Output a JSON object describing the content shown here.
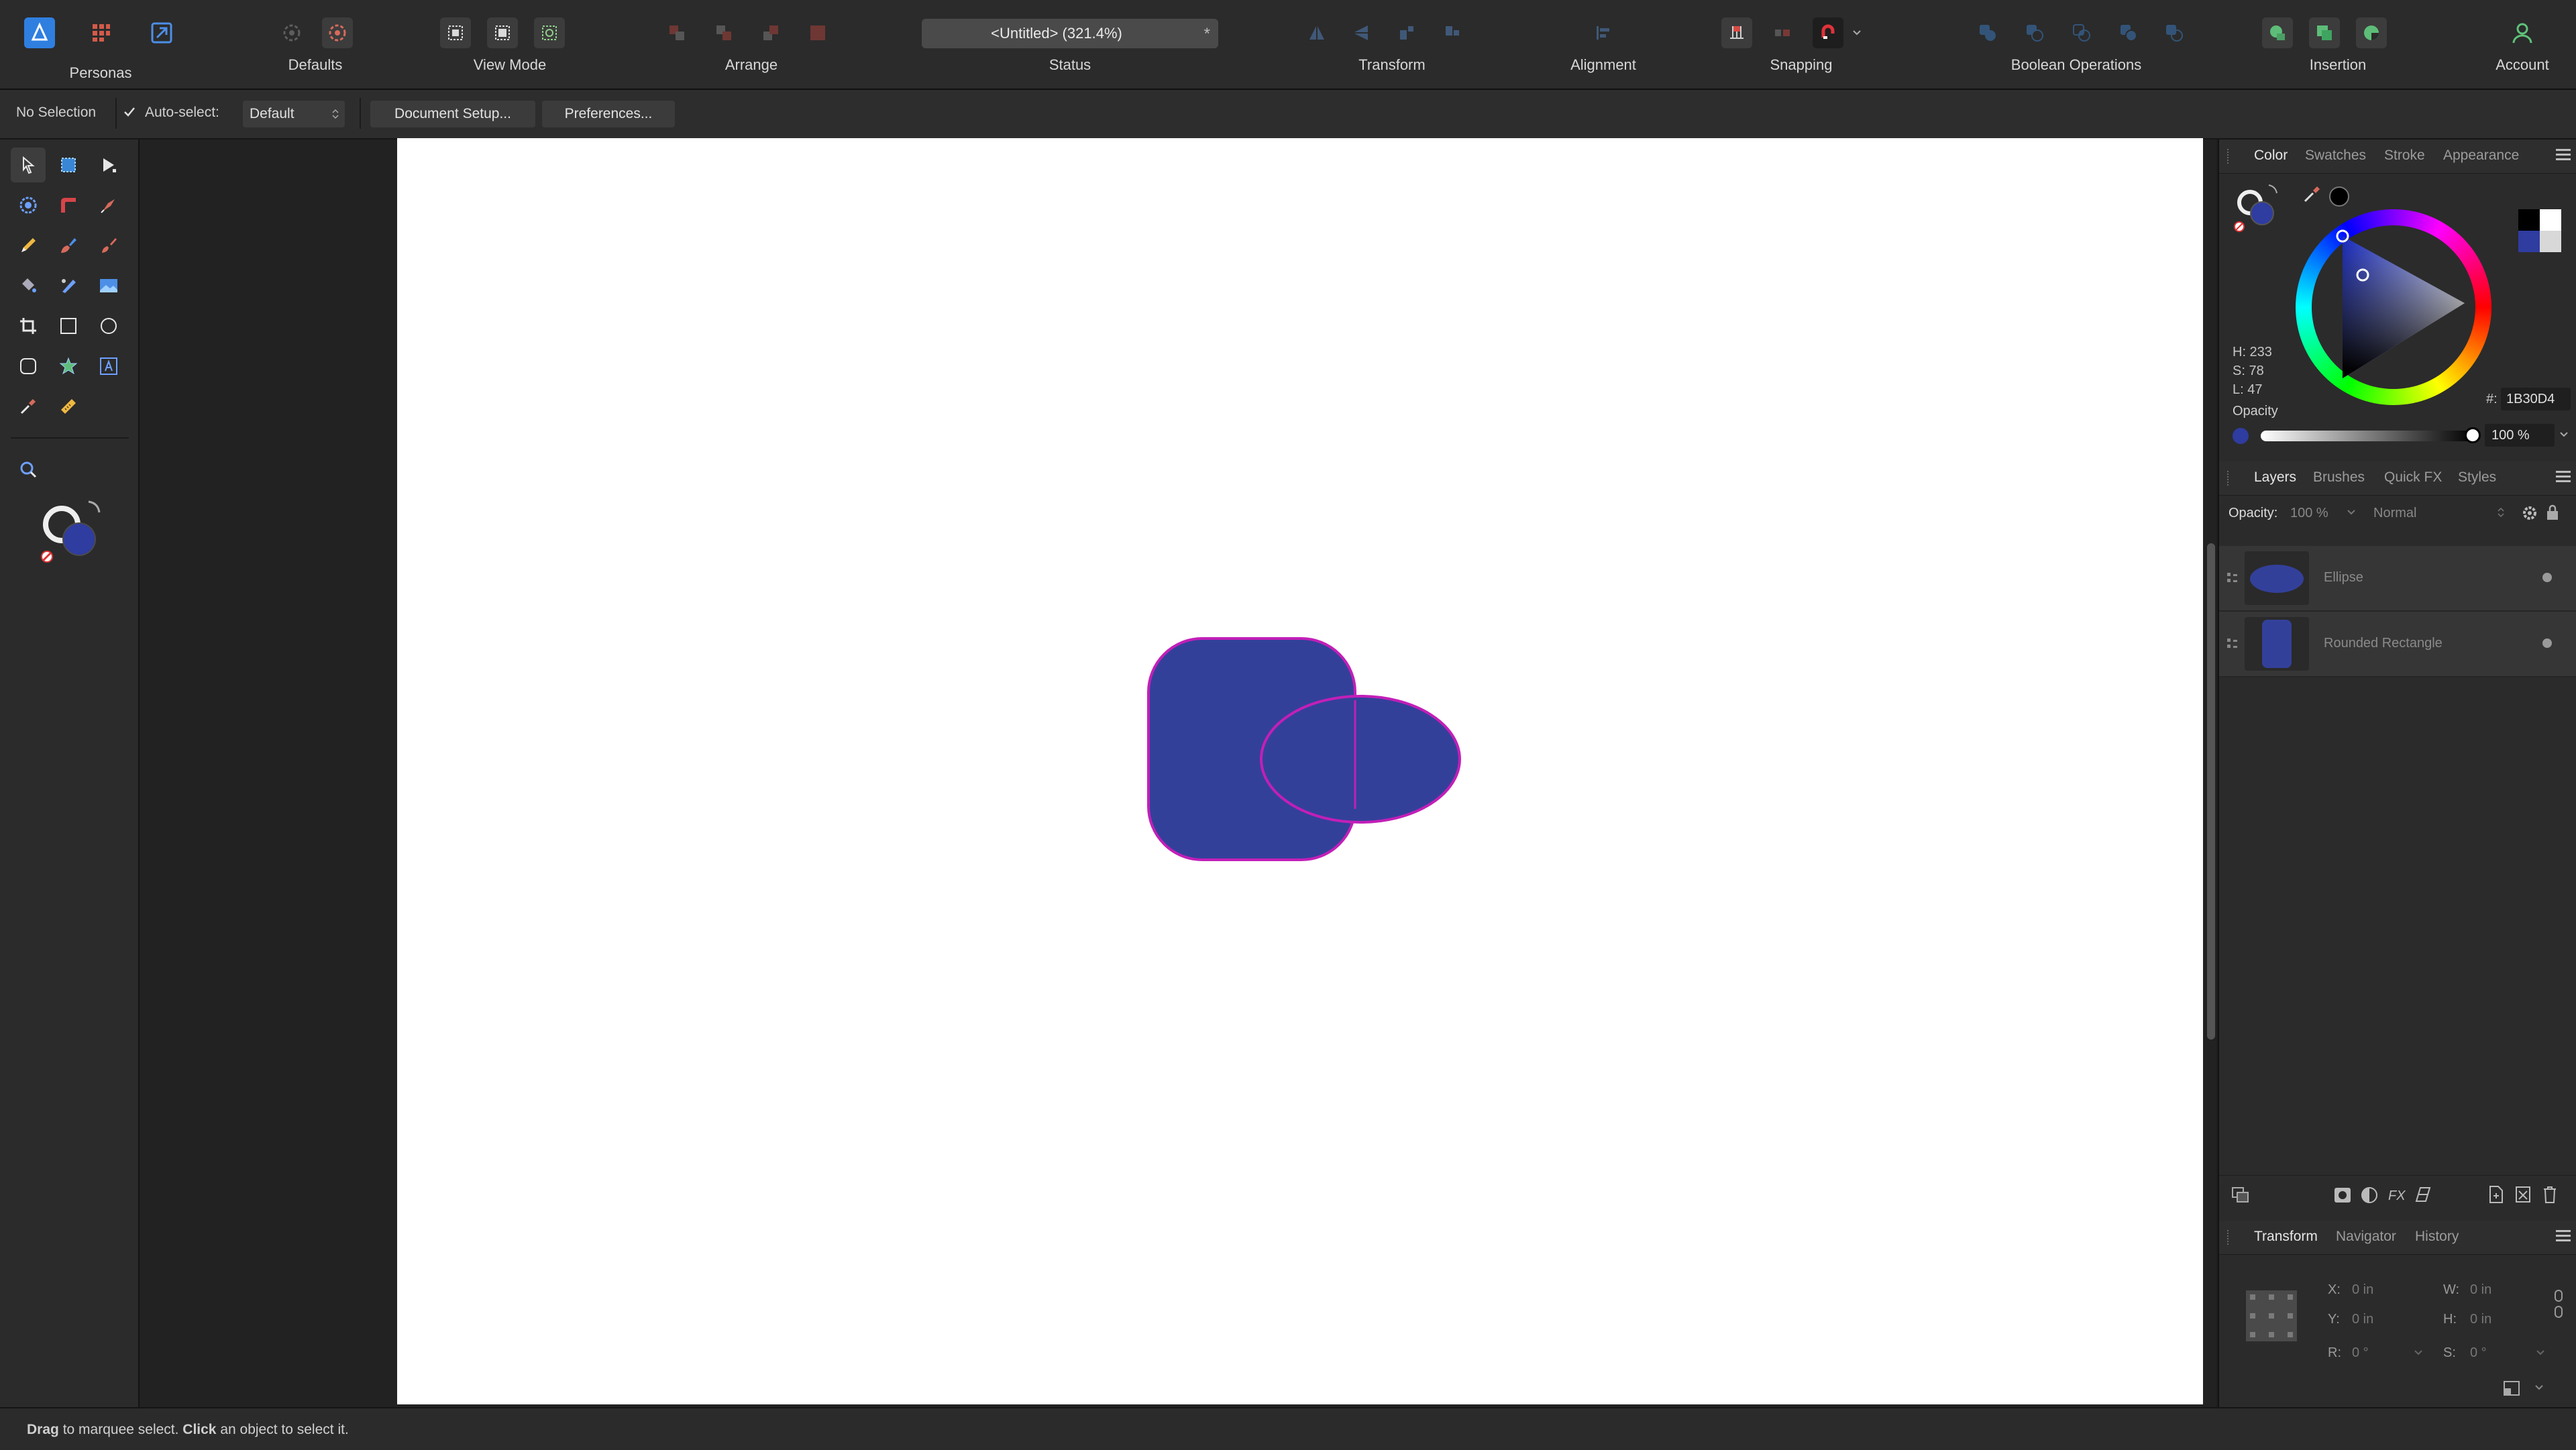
{
  "toolbar": {
    "personas_label": "Personas",
    "defaults_label": "Defaults",
    "view_mode_label": "View Mode",
    "arrange_label": "Arrange",
    "status_label": "Status",
    "document_title": "<Untitled> (321.4%)",
    "document_modified_mark": "*",
    "transform_label": "Transform",
    "alignment_label": "Alignment",
    "snapping_label": "Snapping",
    "boolean_label": "Boolean Operations",
    "insertion_label": "Insertion",
    "account_label": "Account"
  },
  "context_bar": {
    "selection_text": "No Selection",
    "auto_select_label": "Auto-select:",
    "auto_select_checked": true,
    "auto_select_value": "Default",
    "document_setup_label": "Document Setup...",
    "preferences_label": "Preferences..."
  },
  "color_panel": {
    "tabs": [
      "Color",
      "Swatches",
      "Stroke",
      "Appearance"
    ],
    "active_tab": "Color",
    "h": "H: 233",
    "s": "S: 78",
    "l": "L: 47",
    "hex_label": "#:",
    "hex_value": "1B30D4",
    "opacity_label": "Opacity",
    "opacity_value": "100 %",
    "fill_color": "#2f3ca0"
  },
  "layers_panel": {
    "tabs": [
      "Layers",
      "Brushes",
      "Quick FX",
      "Styles"
    ],
    "active_tab": "Layers",
    "opacity_label": "Opacity:",
    "opacity_value": "100 %",
    "blend_mode": "Normal",
    "layers": [
      {
        "name": "Ellipse",
        "shape": "ellipse"
      },
      {
        "name": "Rounded Rectangle",
        "shape": "rounded-rectangle"
      }
    ]
  },
  "transform_panel": {
    "tabs": [
      "Transform",
      "Navigator",
      "History"
    ],
    "active_tab": "Transform",
    "x_label": "X:",
    "x_value": "0 in",
    "y_label": "Y:",
    "y_value": "0 in",
    "w_label": "W:",
    "w_value": "0 in",
    "h_label": "H:",
    "h_value": "0 in",
    "r_label": "R:",
    "r_value": "0 °",
    "s_label": "S:",
    "s_value": "0 °"
  },
  "status_bar": {
    "bold1": "Drag",
    "text1": " to marquee select. ",
    "bold2": "Click",
    "text2": " an object to select it."
  },
  "colors": {
    "shape_fill": "#33409a",
    "shape_stroke": "#c21fb8",
    "accent": "#3a7bd5"
  }
}
